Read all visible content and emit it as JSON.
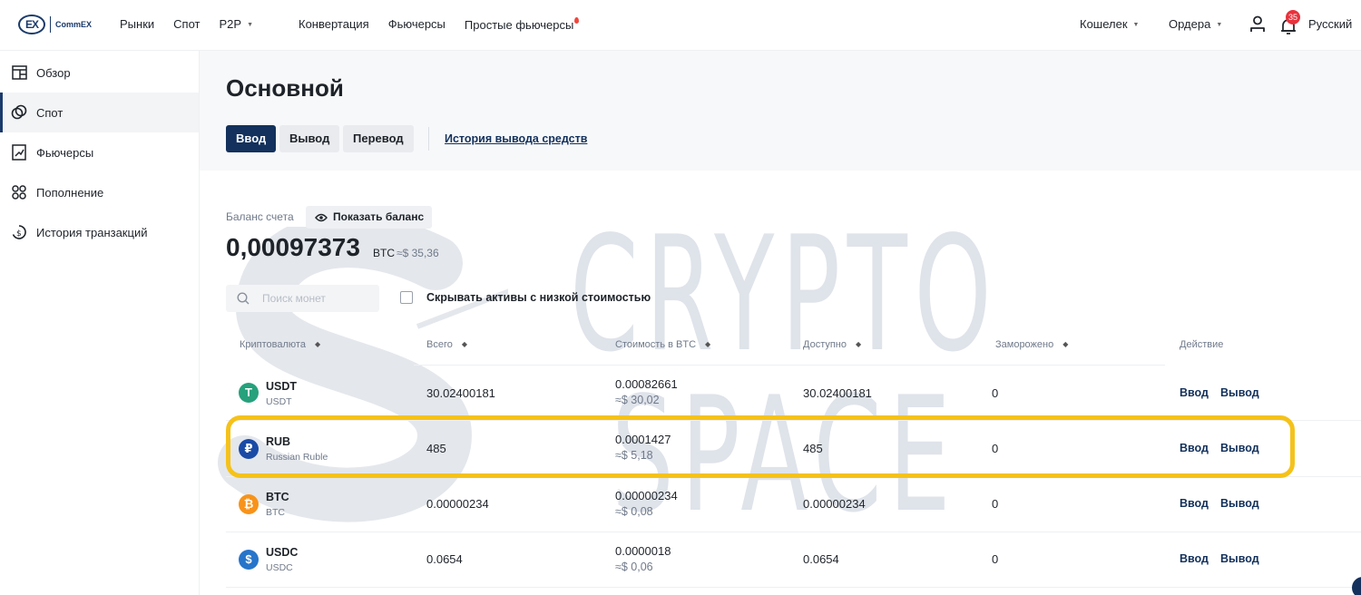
{
  "nav": {
    "logo_text": "CommEX",
    "logo_mark": "EX",
    "items": [
      {
        "label": "Рынки"
      },
      {
        "label": "Спот"
      },
      {
        "label": "P2P"
      },
      {
        "label": "Конвертация"
      },
      {
        "label": "Фьючерсы"
      },
      {
        "label": "Простые фьючерсы"
      }
    ],
    "wallet": "Кошелек",
    "orders": "Ордера",
    "notifications_count": "35",
    "language": "Русский"
  },
  "sidebar": {
    "items": [
      {
        "label": "Обзор",
        "icon": "overview-icon"
      },
      {
        "label": "Спот",
        "icon": "spot-icon"
      },
      {
        "label": "Фьючерсы",
        "icon": "futures-icon"
      },
      {
        "label": "Пополнение",
        "icon": "funding-icon"
      },
      {
        "label": "История транзакций",
        "icon": "history-icon"
      }
    ],
    "active_index": 1
  },
  "header": {
    "title": "Основной",
    "tabs": {
      "deposit": "Ввод",
      "withdraw": "Вывод",
      "transfer": "Перевод"
    },
    "history_link": "История вывода средств"
  },
  "watermark": {
    "line1": "CRYPTO",
    "line2": "SPACE"
  },
  "balance": {
    "label": "Баланс счета",
    "show_button": "Показать баланс",
    "value": "0,00097373",
    "unit": "BTC",
    "usd": "≈$ 35,36"
  },
  "search": {
    "placeholder": "Поиск монет"
  },
  "filter": {
    "hide_small_label": "Скрывать активы с низкой стоимостью"
  },
  "table": {
    "headers": {
      "coin": "Криптовалюта",
      "total": "Всего",
      "btc_value": "Стоимость в BTC",
      "available": "Доступно",
      "frozen": "Заморожено",
      "action": "Действие"
    },
    "rows": [
      {
        "symbol": "USDT",
        "name": "USDT",
        "icon_glyph": "T",
        "icon_color": "#26a17b",
        "total": "30.02400181",
        "btc": "0.00082661",
        "usd": "≈$ 30,02",
        "available": "30.02400181",
        "frozen": "0",
        "deposit": "Ввод",
        "withdraw": "Вывод"
      },
      {
        "symbol": "RUB",
        "name": "Russian Ruble",
        "icon_glyph": "₽",
        "icon_color": "#1b4aa6",
        "total": "485",
        "btc": "0.0001427",
        "usd": "≈$ 5,18",
        "available": "485",
        "frozen": "0",
        "deposit": "Ввод",
        "withdraw": "Вывод"
      },
      {
        "symbol": "BTC",
        "name": "BTC",
        "icon_glyph": "₿",
        "icon_color": "#f7931a",
        "total": "0.00000234",
        "btc": "0.00000234",
        "usd": "≈$ 0,08",
        "available": "0.00000234",
        "frozen": "0",
        "deposit": "Ввод",
        "withdraw": "Вывод"
      },
      {
        "symbol": "USDC",
        "name": "USDC",
        "icon_glyph": "$",
        "icon_color": "#2775ca",
        "total": "0.0654",
        "btc": "0.0000018",
        "usd": "≈$ 0,06",
        "available": "0.0654",
        "frozen": "0",
        "deposit": "Ввод",
        "withdraw": "Вывод"
      }
    ]
  },
  "colors": {
    "accent": "#13315c",
    "highlight": "#f5c21a",
    "badge": "#e8323c"
  }
}
